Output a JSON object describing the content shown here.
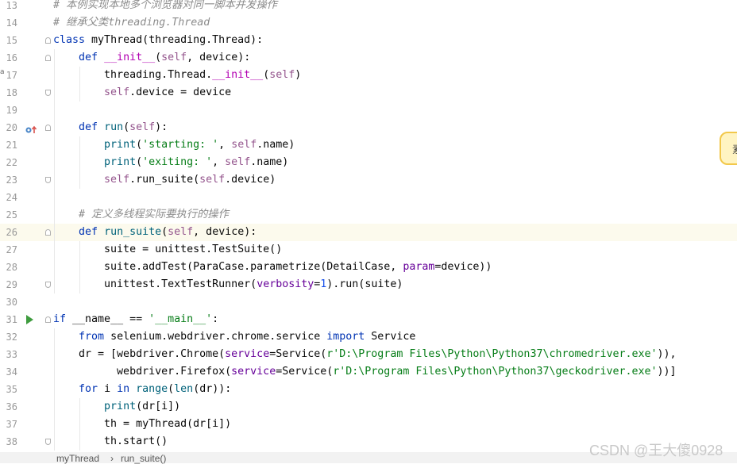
{
  "colors": {
    "keyword": "#0033b3",
    "function": "#00627a",
    "dunder": "#b200b2",
    "self": "#94558d",
    "string": "#067d17",
    "number": "#1750eb",
    "param": "#660099",
    "comment": "#8c8c8c",
    "current_line": "#fcfaed"
  },
  "editor": {
    "lines": [
      {
        "n": "13",
        "code": [
          {
            "t": "cm",
            "v": "# 本例实现本地多个浏览器对同一脚本并发操作"
          }
        ]
      },
      {
        "n": "14",
        "code": [
          {
            "t": "cm",
            "v": "# 继承父类threading.Thread"
          }
        ]
      },
      {
        "n": "15",
        "code": [
          {
            "t": "kw",
            "v": "class "
          },
          {
            "t": "p",
            "v": "myThread(threading.Thread):"
          }
        ]
      },
      {
        "n": "16",
        "code": [
          {
            "t": "p",
            "v": "    "
          },
          {
            "t": "kw",
            "v": "def "
          },
          {
            "t": "dunder",
            "v": "__init__"
          },
          {
            "t": "p",
            "v": "("
          },
          {
            "t": "self",
            "v": "self"
          },
          {
            "t": "p",
            "v": ", device):"
          }
        ]
      },
      {
        "n": "17",
        "code": [
          {
            "t": "p",
            "v": "        threading.Thread."
          },
          {
            "t": "dunder",
            "v": "__init__"
          },
          {
            "t": "p",
            "v": "("
          },
          {
            "t": "self",
            "v": "self"
          },
          {
            "t": "p",
            "v": ")"
          }
        ]
      },
      {
        "n": "18",
        "code": [
          {
            "t": "p",
            "v": "        "
          },
          {
            "t": "self",
            "v": "self"
          },
          {
            "t": "p",
            "v": ".device = device"
          }
        ]
      },
      {
        "n": "19",
        "code": []
      },
      {
        "n": "20",
        "code": [
          {
            "t": "p",
            "v": "    "
          },
          {
            "t": "kw",
            "v": "def "
          },
          {
            "t": "fn",
            "v": "run"
          },
          {
            "t": "p",
            "v": "("
          },
          {
            "t": "self",
            "v": "self"
          },
          {
            "t": "p",
            "v": "):"
          }
        ]
      },
      {
        "n": "21",
        "code": [
          {
            "t": "p",
            "v": "        "
          },
          {
            "t": "fn",
            "v": "print"
          },
          {
            "t": "p",
            "v": "("
          },
          {
            "t": "str",
            "v": "'starting: '"
          },
          {
            "t": "p",
            "v": ", "
          },
          {
            "t": "self",
            "v": "self"
          },
          {
            "t": "p",
            "v": ".name)"
          }
        ]
      },
      {
        "n": "22",
        "code": [
          {
            "t": "p",
            "v": "        "
          },
          {
            "t": "fn",
            "v": "print"
          },
          {
            "t": "p",
            "v": "("
          },
          {
            "t": "str",
            "v": "'exiting: '"
          },
          {
            "t": "p",
            "v": ", "
          },
          {
            "t": "self",
            "v": "self"
          },
          {
            "t": "p",
            "v": ".name)"
          }
        ]
      },
      {
        "n": "23",
        "code": [
          {
            "t": "p",
            "v": "        "
          },
          {
            "t": "self",
            "v": "self"
          },
          {
            "t": "p",
            "v": ".run_suite("
          },
          {
            "t": "self",
            "v": "self"
          },
          {
            "t": "p",
            "v": ".device)"
          }
        ]
      },
      {
        "n": "24",
        "code": []
      },
      {
        "n": "25",
        "code": [
          {
            "t": "p",
            "v": "    "
          },
          {
            "t": "cm",
            "v": "# 定义多线程实际要执行的操作"
          }
        ]
      },
      {
        "n": "26",
        "code": [
          {
            "t": "p",
            "v": "    "
          },
          {
            "t": "kw",
            "v": "def "
          },
          {
            "t": "fn",
            "v": "run_suite"
          },
          {
            "t": "p",
            "v": "("
          },
          {
            "t": "self",
            "v": "self"
          },
          {
            "t": "p",
            "v": ", device):"
          }
        ]
      },
      {
        "n": "27",
        "code": [
          {
            "t": "p",
            "v": "        suite = unittest.TestSuite()"
          }
        ]
      },
      {
        "n": "28",
        "code": [
          {
            "t": "p",
            "v": "        suite.addTest(ParaCase.parametrize(DetailCase, "
          },
          {
            "t": "param",
            "v": "param"
          },
          {
            "t": "p",
            "v": "=device))"
          }
        ]
      },
      {
        "n": "29",
        "code": [
          {
            "t": "p",
            "v": "        unittest.TextTestRunner("
          },
          {
            "t": "param",
            "v": "verbosity"
          },
          {
            "t": "p",
            "v": "="
          },
          {
            "t": "num",
            "v": "1"
          },
          {
            "t": "p",
            "v": ").run(suite)"
          }
        ]
      },
      {
        "n": "30",
        "code": []
      },
      {
        "n": "31",
        "code": [
          {
            "t": "kw",
            "v": "if "
          },
          {
            "t": "p",
            "v": "__name__ == "
          },
          {
            "t": "str",
            "v": "'__main__'"
          },
          {
            "t": "p",
            "v": ":"
          }
        ]
      },
      {
        "n": "32",
        "code": [
          {
            "t": "p",
            "v": "    "
          },
          {
            "t": "kw",
            "v": "from "
          },
          {
            "t": "p",
            "v": "selenium.webdriver.chrome.service "
          },
          {
            "t": "kw",
            "v": "import "
          },
          {
            "t": "p",
            "v": "Service"
          }
        ]
      },
      {
        "n": "33",
        "code": [
          {
            "t": "p",
            "v": "    dr = [webdriver.Chrome("
          },
          {
            "t": "param",
            "v": "service"
          },
          {
            "t": "p",
            "v": "=Service("
          },
          {
            "t": "str",
            "v": "r'D:\\Program Files\\Python\\Python37\\chromedriver.exe'"
          },
          {
            "t": "p",
            "v": ")),"
          }
        ]
      },
      {
        "n": "34",
        "code": [
          {
            "t": "p",
            "v": "          webdriver.Firefox("
          },
          {
            "t": "param",
            "v": "service"
          },
          {
            "t": "p",
            "v": "=Service("
          },
          {
            "t": "str",
            "v": "r'D:\\Program Files\\Python\\Python37\\geckodriver.exe'"
          },
          {
            "t": "p",
            "v": "))]"
          }
        ]
      },
      {
        "n": "35",
        "code": [
          {
            "t": "p",
            "v": "    "
          },
          {
            "t": "kw",
            "v": "for "
          },
          {
            "t": "p",
            "v": "i "
          },
          {
            "t": "kw",
            "v": "in "
          },
          {
            "t": "fn",
            "v": "range"
          },
          {
            "t": "p",
            "v": "("
          },
          {
            "t": "fn",
            "v": "len"
          },
          {
            "t": "p",
            "v": "(dr)):"
          }
        ]
      },
      {
        "n": "36",
        "code": [
          {
            "t": "p",
            "v": "        "
          },
          {
            "t": "fn",
            "v": "print"
          },
          {
            "t": "p",
            "v": "(dr[i])"
          }
        ]
      },
      {
        "n": "37",
        "code": [
          {
            "t": "p",
            "v": "        th = myThread(dr[i])"
          }
        ]
      },
      {
        "n": "38",
        "code": [
          {
            "t": "p",
            "v": "        th.start()"
          }
        ]
      }
    ]
  },
  "breadcrumb": {
    "item1": "myThread",
    "separator": "›",
    "item2": "run_suite()"
  },
  "watermark": "CSDN @王大傻0928",
  "side_bubble": "素",
  "left_tick": "a"
}
